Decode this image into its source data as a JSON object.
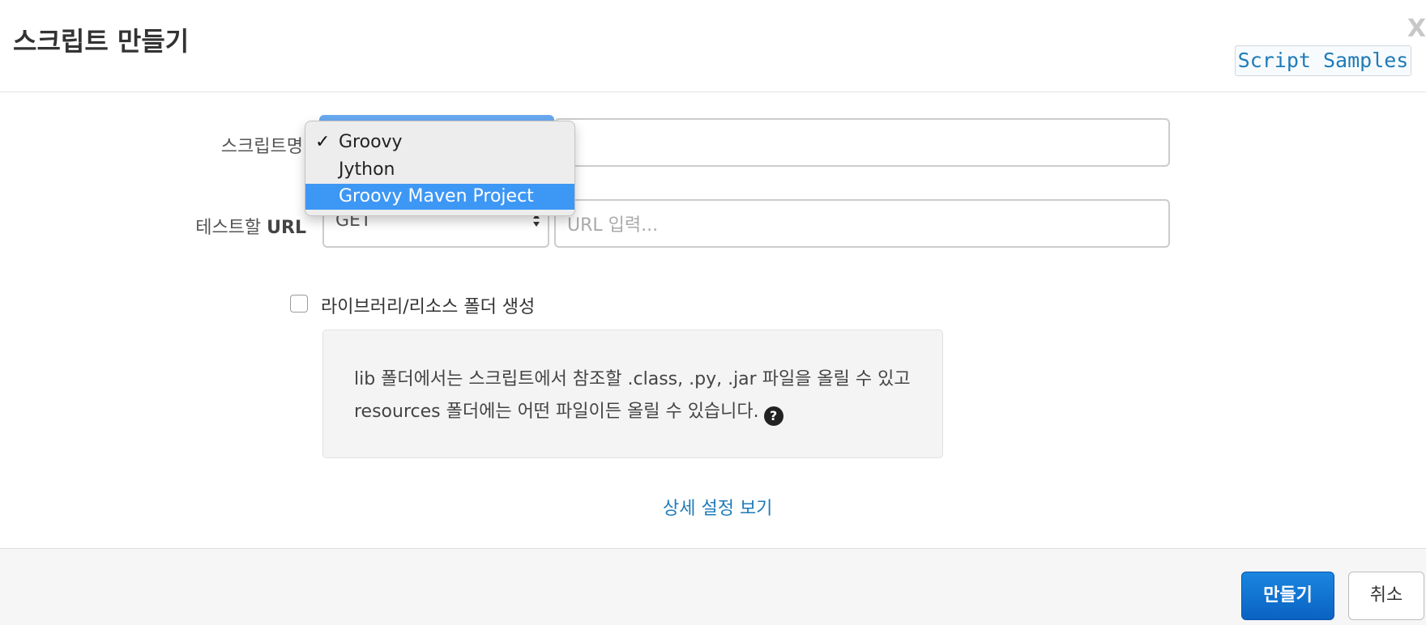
{
  "header": {
    "title": "스크립트 만들기",
    "close_label": "X",
    "samples_label": "Script Samples"
  },
  "form": {
    "script_name_label": "스크립트명",
    "test_url_label_prefix": "테스트할",
    "test_url_label_bold": "URL",
    "method_value": "GET",
    "url_placeholder": "URL 입력...",
    "library_checkbox_label": "라이브러리/리소스 폴더 생성",
    "library_checkbox_checked": false
  },
  "info": {
    "line1": "lib 폴더에서는 스크립트에서 참조할 .class, .py, .jar 파일을 올릴 수 있고",
    "line2": "resources 폴더에는 어떤 파일이든 올릴 수 있습니다.",
    "help_icon": "?"
  },
  "advanced_link": "상세 설정 보기",
  "footer": {
    "create_label": "만들기",
    "cancel_label": "취소"
  },
  "dropdown": {
    "checkmark": "✓",
    "options": [
      {
        "label": "Groovy",
        "checked": true,
        "highlighted": false
      },
      {
        "label": "Jython",
        "checked": false,
        "highlighted": false
      },
      {
        "label": "Groovy Maven Project",
        "checked": false,
        "highlighted": true
      }
    ]
  },
  "colors": {
    "accent": "#1f7bb8",
    "primary_button": "#0a62c2",
    "highlight": "#3d97f5"
  }
}
